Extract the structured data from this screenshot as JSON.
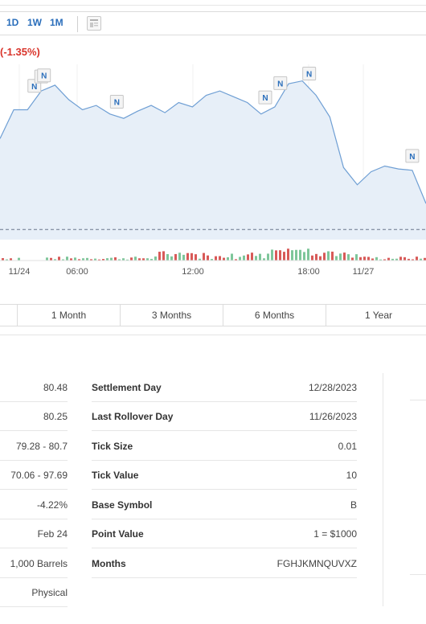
{
  "toolbar": {
    "ranges": [
      "1D",
      "1W",
      "1M"
    ]
  },
  "quote": {
    "change_pct": "(-1.35%)"
  },
  "chart_data": {
    "type": "area",
    "x_ticks": [
      "11/24",
      "06:00",
      "12:00",
      "18:00",
      "11/27"
    ],
    "y_values": [
      79.25,
      79.45,
      79.45,
      79.58,
      79.62,
      79.52,
      79.45,
      79.48,
      79.42,
      79.39,
      79.44,
      79.48,
      79.43,
      79.5,
      79.47,
      79.55,
      79.58,
      79.54,
      79.5,
      79.42,
      79.47,
      79.63,
      79.65,
      79.55,
      79.4,
      79.05,
      78.93,
      79.02,
      79.06,
      79.04,
      79.03,
      78.8
    ],
    "reference_line": 78.62,
    "news_markers": 8,
    "colors": {
      "line": "#6f9fd4",
      "fill": "#e7eff8",
      "reference": "#8a96a8",
      "volume_up": "#7ec69a",
      "volume_down": "#d85a58",
      "change_negative": "#d9342b",
      "accent": "#2a6ebb"
    }
  },
  "periods": [
    "1 Month",
    "3 Months",
    "6 Months",
    "1 Year"
  ],
  "details_left": {
    "values": [
      "80.48",
      "80.25",
      "79.28 - 80.7",
      "70.06 - 97.69",
      "-4.22%",
      "Feb 24",
      "1,000 Barrels",
      "Physical"
    ]
  },
  "details_right": [
    {
      "label": "Settlement Day",
      "value": "12/28/2023"
    },
    {
      "label": "Last Rollover Day",
      "value": "11/26/2023"
    },
    {
      "label": "Tick Size",
      "value": "0.01"
    },
    {
      "label": "Tick Value",
      "value": "10"
    },
    {
      "label": "Base Symbol",
      "value": "B"
    },
    {
      "label": "Point Value",
      "value": "1 = $1000"
    },
    {
      "label": "Months",
      "value": "FGHJKMNQUVXZ"
    }
  ]
}
